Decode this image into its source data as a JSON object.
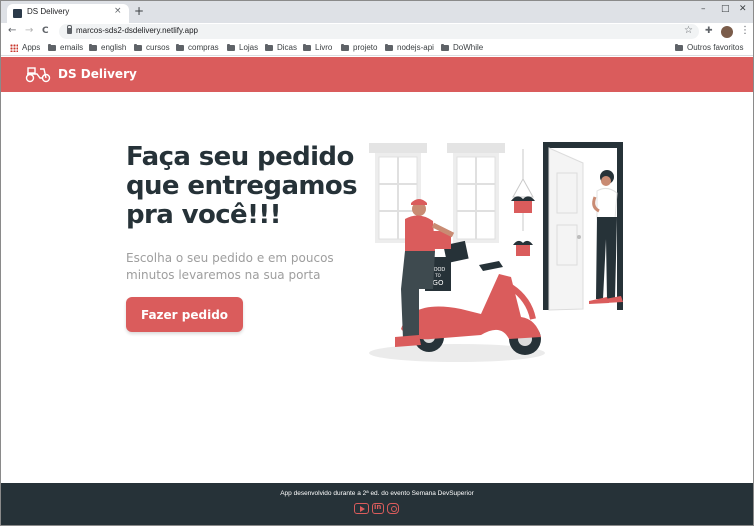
{
  "browser": {
    "tab_title": "DS Delivery",
    "tab_close": "×",
    "new_tab": "+",
    "url": "marcos-sds2-dsdelivery.netlify.app",
    "nav": {
      "back": "←",
      "forward": "→",
      "reload": "C"
    },
    "window_controls": {
      "minimize": "–",
      "maximize": "□",
      "close": "✕"
    },
    "bookmarks": [
      {
        "label": "Apps",
        "icon": "apps-icon"
      },
      {
        "label": "emails",
        "icon": "folder-icon"
      },
      {
        "label": "english",
        "icon": "folder-icon"
      },
      {
        "label": "cursos",
        "icon": "folder-icon"
      },
      {
        "label": "compras",
        "icon": "folder-icon"
      },
      {
        "label": "Lojas",
        "icon": "folder-icon"
      },
      {
        "label": "Dicas",
        "icon": "folder-icon"
      },
      {
        "label": "Livro",
        "icon": "folder-icon"
      },
      {
        "label": "projeto",
        "icon": "folder-icon"
      },
      {
        "label": "nodejs-api",
        "icon": "folder-icon"
      },
      {
        "label": "DoWhile",
        "icon": "folder-icon"
      }
    ],
    "other_bookmarks": "Outros favoritos"
  },
  "header": {
    "brand": "DS Delivery",
    "logo_icon": "scooter-icon"
  },
  "hero": {
    "title": "Faça seu pedido que entregamos pra você!!!",
    "subtitle": "Escolha o seu pedido e em poucos minutos levaremos na sua porta",
    "cta_label": "Fazer pedido",
    "illustration_box_text": [
      "FOOD",
      "TO",
      "GO"
    ]
  },
  "footer": {
    "text": "App desenvolvido durante a 2ª ed. do evento Semana DevSuperior",
    "social_icons": [
      "youtube-icon",
      "linkedin-icon",
      "instagram-icon"
    ]
  },
  "colors": {
    "primary": "#da5c5c",
    "dark": "#263238",
    "muted_text": "#9e9e9e"
  }
}
